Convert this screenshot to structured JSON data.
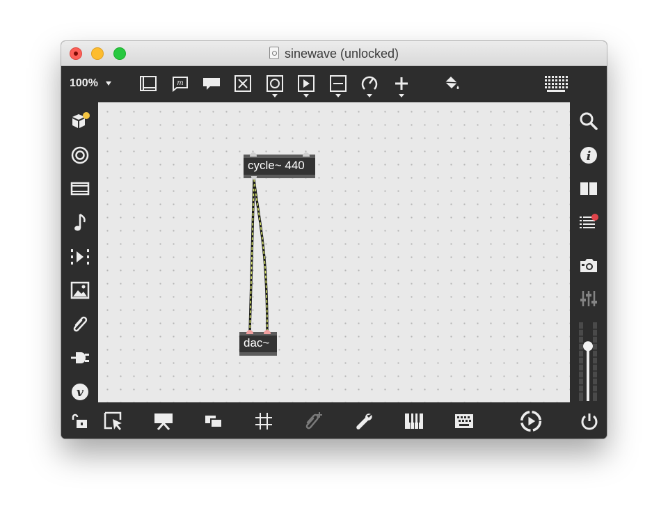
{
  "window": {
    "title": "sinewave (unlocked)"
  },
  "toolbar": {
    "zoom": "100%",
    "items": [
      {
        "icon": "object-box-icon"
      },
      {
        "icon": "message-box-icon",
        "glyph": "m"
      },
      {
        "icon": "comment-icon"
      },
      {
        "icon": "toggle-icon"
      },
      {
        "icon": "button-icon"
      },
      {
        "icon": "play-icon"
      },
      {
        "icon": "slider-icon"
      },
      {
        "icon": "dial-icon"
      },
      {
        "icon": "add-object-icon"
      },
      {
        "icon": "paint-bucket-icon"
      },
      {
        "icon": "grid-preset-icon"
      }
    ]
  },
  "left_sidebar": [
    {
      "icon": "packages-icon",
      "badge_color": "#f5c542"
    },
    {
      "icon": "target-icon"
    },
    {
      "icon": "film-icon"
    },
    {
      "icon": "music-note-icon"
    },
    {
      "icon": "media-step-icon"
    },
    {
      "icon": "image-icon"
    },
    {
      "icon": "paperclip-icon"
    },
    {
      "icon": "plug-icon"
    },
    {
      "icon": "vizzie-icon",
      "glyph": "v"
    }
  ],
  "right_sidebar": [
    {
      "icon": "search-icon"
    },
    {
      "icon": "info-icon",
      "glyph": "i"
    },
    {
      "icon": "book-icon"
    },
    {
      "icon": "list-icon",
      "badge_color": "#e0444b"
    },
    {
      "icon": "camera-icon"
    },
    {
      "icon": "mixer-icon"
    }
  ],
  "patch": {
    "objects": [
      {
        "id": "cycle",
        "text": "cycle~ 440"
      },
      {
        "id": "dac",
        "text": "dac~"
      }
    ],
    "patchcord_color": "#d6e36a"
  },
  "bottom_bar": [
    {
      "icon": "lock-icon"
    },
    {
      "icon": "select-cursor-icon"
    },
    {
      "icon": "presentation-icon"
    },
    {
      "icon": "windows-icon"
    },
    {
      "icon": "grid-icon"
    },
    {
      "icon": "paperclip-add-icon"
    },
    {
      "icon": "wrench-icon"
    },
    {
      "icon": "piano-icon"
    },
    {
      "icon": "keyboard-icon"
    },
    {
      "icon": "audio-play-icon"
    },
    {
      "icon": "power-icon"
    }
  ],
  "volume": {
    "level": 0.72
  },
  "colors": {
    "chrome": "#2d2d2d",
    "canvas": "#e9e9e9",
    "icon": "#ededed",
    "object": "#333333"
  }
}
